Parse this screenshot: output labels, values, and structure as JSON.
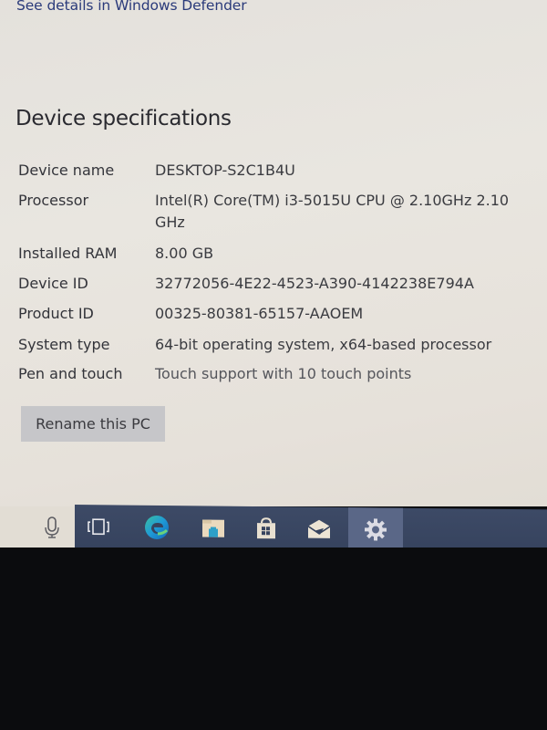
{
  "security_link": "See details in Windows Defender",
  "section_title": "Device specifications",
  "specs": [
    {
      "label": "Device name",
      "value": "DESKTOP-S2C1B4U"
    },
    {
      "label": "Processor",
      "value": "Intel(R) Core(TM) i3-5015U CPU @ 2.10GHz   2.10 GHz"
    },
    {
      "label": "Installed RAM",
      "value": "8.00 GB"
    },
    {
      "label": "Device ID",
      "value": "32772056-4E22-4523-A390-4142238E794A"
    },
    {
      "label": "Product ID",
      "value": "00325-80381-65157-AAOEM"
    },
    {
      "label": "System type",
      "value": "64-bit operating system, x64-based processor"
    },
    {
      "label": "Pen and touch",
      "value": "Touch support with 10 touch points"
    }
  ],
  "rename_button": "Rename this PC",
  "taskbar": {
    "items": [
      {
        "icon": "microphone-icon",
        "name": "Cortana voice"
      },
      {
        "icon": "task-view-icon",
        "name": "Task View"
      },
      {
        "icon": "edge-icon",
        "name": "Microsoft Edge"
      },
      {
        "icon": "file-explorer-icon",
        "name": "File Explorer"
      },
      {
        "icon": "store-icon",
        "name": "Microsoft Store"
      },
      {
        "icon": "mail-icon",
        "name": "Mail"
      },
      {
        "icon": "settings-gear-icon",
        "name": "Settings",
        "active": true
      }
    ],
    "colors": {
      "taskbar_bg": "#3a4762",
      "active_bg": "#5a6787",
      "edge_blue": "#1e88c8",
      "edge_green": "#4cc06a",
      "folder_tan": "#e8d8b8"
    }
  }
}
